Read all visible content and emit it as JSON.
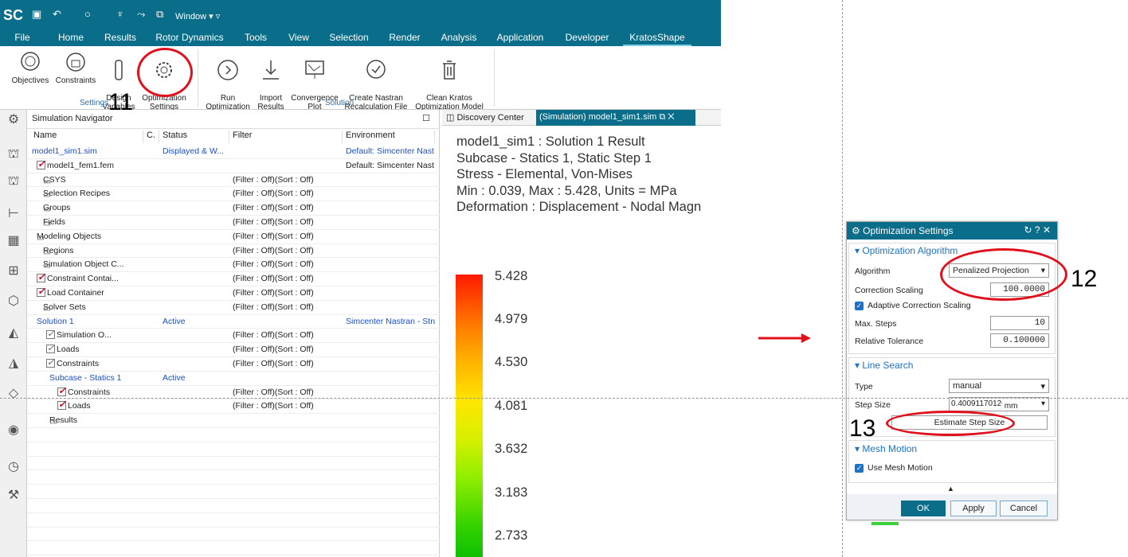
{
  "app": {
    "logo": "SC",
    "window_menu": "Window"
  },
  "menu": [
    "File",
    "Home",
    "Results",
    "Rotor Dynamics",
    "Tools",
    "View",
    "Selection",
    "Render",
    "Analysis",
    "Application",
    "Developer",
    "KratosShape"
  ],
  "ribbon": {
    "objectives": "Objectives",
    "constraints": "Constraints",
    "design_variables": "Design\nVariables",
    "optimization_settings": "Optimization\nSettings",
    "run_optimization": "Run\nOptimization",
    "import_results": "Import\nResults",
    "convergence_plot": "Convergence\nPlot",
    "create_nastran": "Create Nastran\nRecalculation File",
    "clean_kratos": "Clean Kratos\nOptimization Model",
    "group_settings": "Settings",
    "group_solution": "Solution"
  },
  "navigator": {
    "title": "Simulation Navigator",
    "columns": [
      "Name",
      "C.",
      "Status",
      "Filter",
      "Environment"
    ],
    "rows": [
      {
        "name": "model1_sim1.sim",
        "status": "Displayed & W...",
        "filter": "",
        "env": "Default: Simcenter Nast",
        "blue": true
      },
      {
        "name": "model1_fem1.fem",
        "status": "",
        "filter": "",
        "env": "Default: Simcenter Nast"
      },
      {
        "name": "CSYS",
        "status": "",
        "filter": "(Filter : Off)(Sort : Off)",
        "env": ""
      },
      {
        "name": "Selection Recipes",
        "status": "",
        "filter": "(Filter : Off)(Sort : Off)",
        "env": ""
      },
      {
        "name": "Groups",
        "status": "",
        "filter": "(Filter : Off)(Sort : Off)",
        "env": ""
      },
      {
        "name": "Fields",
        "status": "",
        "filter": "(Filter : Off)(Sort : Off)",
        "env": ""
      },
      {
        "name": "Modeling Objects",
        "status": "",
        "filter": "(Filter : Off)(Sort : Off)",
        "env": ""
      },
      {
        "name": "Regions",
        "status": "",
        "filter": "(Filter : Off)(Sort : Off)",
        "env": ""
      },
      {
        "name": "Simulation Object C...",
        "status": "",
        "filter": "(Filter : Off)(Sort : Off)",
        "env": ""
      },
      {
        "name": "Constraint Contai...",
        "status": "",
        "filter": "(Filter : Off)(Sort : Off)",
        "env": ""
      },
      {
        "name": "Load Container",
        "status": "",
        "filter": "(Filter : Off)(Sort : Off)",
        "env": ""
      },
      {
        "name": "Solver Sets",
        "status": "",
        "filter": "(Filter : Off)(Sort : Off)",
        "env": ""
      },
      {
        "name": "Solution 1",
        "status": "Active",
        "filter": "",
        "env": "Simcenter Nastran - Stru",
        "blue": true
      },
      {
        "name": "Simulation O...",
        "status": "",
        "filter": "(Filter : Off)(Sort : Off)",
        "env": ""
      },
      {
        "name": "Loads",
        "status": "",
        "filter": "(Filter : Off)(Sort : Off)",
        "env": ""
      },
      {
        "name": "Constraints",
        "status": "",
        "filter": "(Filter : Off)(Sort : Off)",
        "env": ""
      },
      {
        "name": "Subcase - Statics 1",
        "status": "Active",
        "filter": "",
        "env": "",
        "blue": true
      },
      {
        "name": "Constraints",
        "status": "",
        "filter": "(Filter : Off)(Sort : Off)",
        "env": ""
      },
      {
        "name": "Loads",
        "status": "",
        "filter": "(Filter : Off)(Sort : Off)",
        "env": ""
      },
      {
        "name": "Results",
        "status": "",
        "filter": "",
        "env": ""
      }
    ]
  },
  "graphics": {
    "tab1": "Discovery Center",
    "tab2": "(Simulation) model1_sim1.sim",
    "result_lines": [
      "model1_sim1 : Solution 1 Result",
      "Subcase - Statics 1, Static Step 1",
      "Stress - Elemental, Von-Mises",
      "Min : 0.039, Max : 5.428, Units = MPa",
      "Deformation : Displacement - Nodal Magn"
    ],
    "legend": [
      "5.428",
      "4.979",
      "4.530",
      "4.081",
      "3.632",
      "3.183",
      "2.733"
    ]
  },
  "dialog": {
    "title": "Optimization Settings",
    "algo_section": "Optimization Algorithm",
    "algorithm_label": "Algorithm",
    "algorithm_value": "Penalized Projection",
    "correction_label": "Correction Scaling",
    "correction_value": "100.0000",
    "adaptive_label": "Adaptive Correction Scaling",
    "maxsteps_label": "Max. Steps",
    "maxsteps_value": "10",
    "reltol_label": "Relative Tolerance",
    "reltol_value": "0.100000",
    "line_section": "Line Search",
    "type_label": "Type",
    "type_value": "manual",
    "stepsize_label": "Step Size",
    "stepsize_value": "0.400911701201",
    "stepsize_unit": "mm",
    "estimate_button": "Estimate Step Size",
    "mesh_section": "Mesh Motion",
    "use_mesh_label": "Use Mesh Motion",
    "ok": "OK",
    "apply": "Apply",
    "cancel": "Cancel"
  },
  "annotations": {
    "n11": "11",
    "n12": "12",
    "n13": "13"
  },
  "colors": {
    "accent": "#0a6e8a",
    "annotation": "#e0111d"
  }
}
